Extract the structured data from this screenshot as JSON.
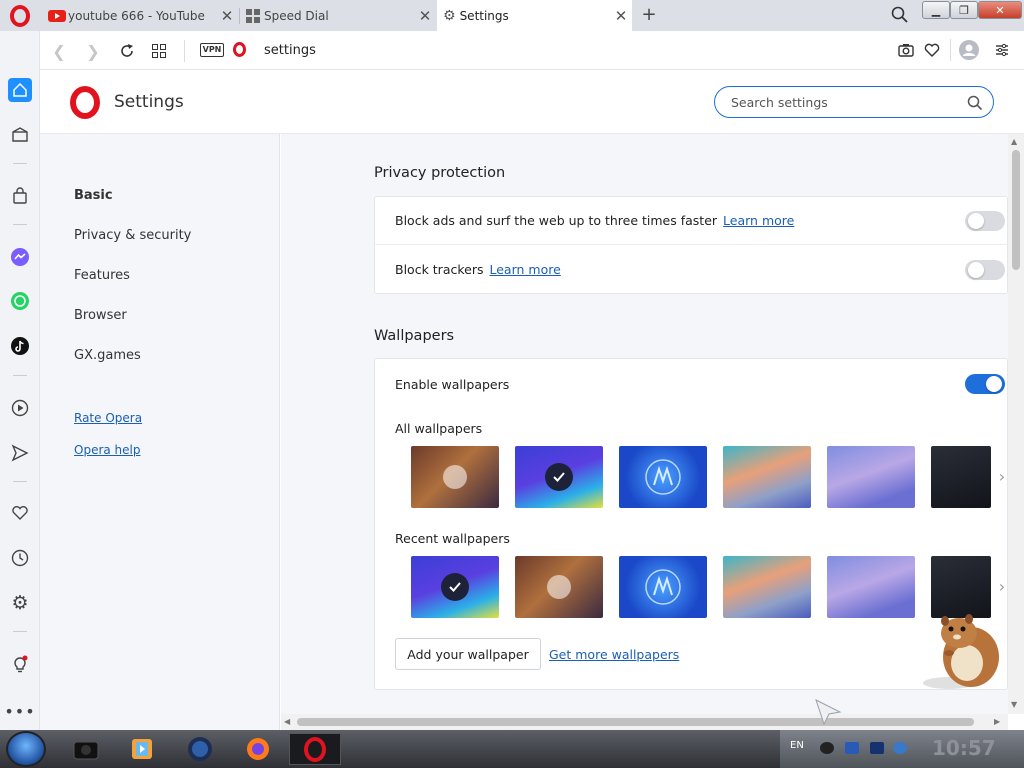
{
  "tabs": [
    {
      "title": "youtube 666 - YouTube",
      "icon": "youtube-icon",
      "active": false
    },
    {
      "title": "Speed Dial",
      "icon": "speed-dial-icon",
      "active": false
    },
    {
      "title": "Settings",
      "icon": "gear-icon",
      "active": true
    }
  ],
  "toolbar": {
    "vpn_label": "VPN",
    "address": "settings"
  },
  "settings": {
    "title": "Settings",
    "search_placeholder": "Search settings"
  },
  "nav": {
    "items": [
      "Basic",
      "Privacy & security",
      "Features",
      "Browser",
      "GX.games"
    ],
    "active_item": "Basic",
    "links": [
      "Rate Opera",
      "Opera help"
    ]
  },
  "privacy": {
    "title": "Privacy protection",
    "rows": [
      {
        "label": "Block ads and surf the web up to three times faster",
        "link": "Learn more",
        "enabled": false
      },
      {
        "label": "Block trackers",
        "link": "Learn more",
        "enabled": false
      }
    ]
  },
  "wallpapers": {
    "title": "Wallpapers",
    "enable_label": "Enable wallpapers",
    "enabled": true,
    "all_label": "All wallpapers",
    "recent_label": "Recent wallpapers",
    "add_button": "Add your wallpaper",
    "get_more_link": "Get more wallpapers"
  },
  "taskbar": {
    "language": "EN",
    "clock": "10:57"
  },
  "colors": {
    "accent": "#1e6fd9",
    "opera_red": "#e0131e",
    "link": "#1a5fb4"
  }
}
